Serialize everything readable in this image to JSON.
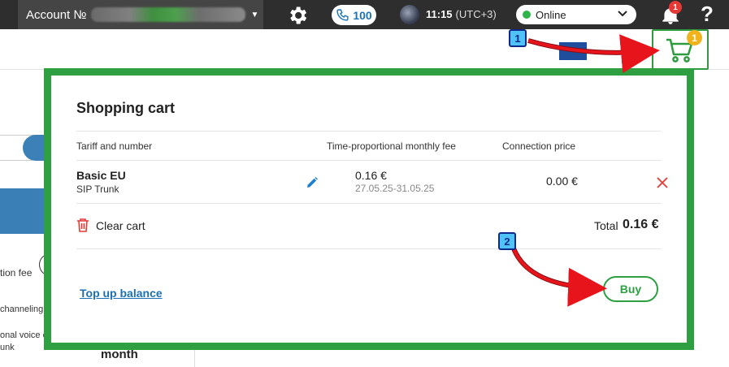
{
  "topbar": {
    "account_label": "Account №",
    "phone_count": "100",
    "time": "11:15",
    "timezone": "(UTC+3)",
    "status_label": "Online",
    "notifications_count": "1",
    "help_glyph": "?"
  },
  "header": {
    "cart_count": "1"
  },
  "background": {
    "text_fee": "tion fee",
    "text_channeling": "channeling",
    "text_voice": "onal voice o",
    "text_unk": "unk",
    "text_month": "month"
  },
  "cart": {
    "title": "Shopping cart",
    "columns": {
      "tariff": "Tariff and number",
      "fee": "Time-proportional monthly fee",
      "connection": "Connection price"
    },
    "items": [
      {
        "name": "Basic EU",
        "type": "SIP Trunk",
        "fee": "0.16 €",
        "period": "27.05.25-31.05.25",
        "connection_price": "0.00 €"
      }
    ],
    "clear_label": "Clear cart",
    "total_label": "Total",
    "total_value": "0.16 €",
    "topup_label": "Top up balance",
    "buy_label": "Buy"
  },
  "annotations": {
    "step1": "1",
    "step2": "2"
  },
  "colors": {
    "accent_green": "#2ea041",
    "link_blue": "#1d6fb3",
    "badge_red": "#e53935",
    "badge_yellow": "#f2b21b",
    "arrow_red": "#e8141b"
  },
  "icons": [
    "gear-icon",
    "phone-icon",
    "bell-icon",
    "cart-icon",
    "pencil-icon",
    "close-icon",
    "trash-icon",
    "chevron-down-icon"
  ]
}
